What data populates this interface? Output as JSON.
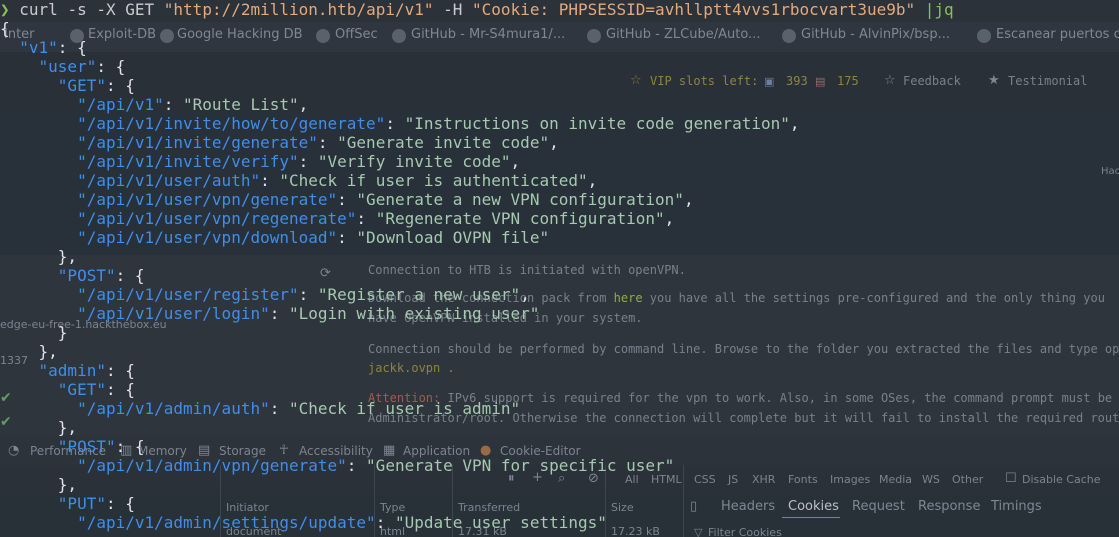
{
  "terminal": {
    "prompt_symbol": "❯",
    "command": {
      "prefix": "curl -s -X GET ",
      "url": "\"http://2million.htb/api/v1\"",
      "middle": " -H ",
      "header": "\"Cookie: PHPSESSID=avhllptt4vvs1rbocvart3ue9b\"",
      "pipe": " |jq"
    },
    "root_key": "\"v1\"",
    "user_key": "\"user\"",
    "admin_key": "\"admin\"",
    "get_key": "\"GET\"",
    "post_key": "\"POST\"",
    "put_key": "\"PUT\"",
    "user_get": [
      {
        "route": "\"/api/v1\"",
        "desc": "\"Route List\""
      },
      {
        "route": "\"/api/v1/invite/how/to/generate\"",
        "desc": "\"Instructions on invite code generation\""
      },
      {
        "route": "\"/api/v1/invite/generate\"",
        "desc": "\"Generate invite code\""
      },
      {
        "route": "\"/api/v1/invite/verify\"",
        "desc": "\"Verify invite code\""
      },
      {
        "route": "\"/api/v1/user/auth\"",
        "desc": "\"Check if user is authenticated\""
      },
      {
        "route": "\"/api/v1/user/vpn/generate\"",
        "desc": "\"Generate a new VPN configuration\""
      },
      {
        "route": "\"/api/v1/user/vpn/regenerate\"",
        "desc": "\"Regenerate VPN configuration\""
      },
      {
        "route": "\"/api/v1/user/vpn/download\"",
        "desc": "\"Download OVPN file\""
      }
    ],
    "user_post": [
      {
        "route": "\"/api/v1/user/register\"",
        "desc": "\"Register a new user\""
      },
      {
        "route": "\"/api/v1/user/login\"",
        "desc": "\"Login with existing user\""
      }
    ],
    "admin_get": [
      {
        "route": "\"/api/v1/admin/auth\"",
        "desc": "\"Check if user is admin\""
      }
    ],
    "admin_post": [
      {
        "route": "\"/api/v1/admin/vpn/generate\"",
        "desc": "\"Generate VPN for specific user\""
      }
    ],
    "admin_put": [
      {
        "route": "\"/api/v1/admin/settings/update\"",
        "desc": "\"Update user settings\""
      }
    ]
  },
  "background": {
    "bookmarks": [
      "Inter",
      "Exploit-DB",
      "Google Hacking DB",
      "OffSec",
      "GitHub - Mr-S4mura1/...",
      "GitHub - ZLCube/Auto...",
      "GitHub - AlvinPix/bsp...",
      "Escanear puertos c"
    ],
    "vip_label": "VIP slots left:",
    "vip_eu": "393",
    "vip_us": "175",
    "feedback": "Feedback",
    "testimonial": "Testimonial",
    "hac_fragment": "Hac",
    "server_fragment": "edge-eu-free-1.hackthebox.eu",
    "port_fragment": "1337",
    "vpn_text_1": "Connection to HTB is initiated with openVPN.",
    "vpn_text_2a": "Download the connection pack from ",
    "vpn_text_2_link": "here",
    "vpn_text_2b": " you have all the settings pre-configured and the only thing you",
    "vpn_text_3": "have OpenVPN installed in your system.",
    "vpn_text_4": "Connection should be performed by command line. Browse to the folder you extracted the files and type  openv",
    "vpn_text_5": "jackk.ovpn .",
    "vpn_text_6a": "Attention:",
    "vpn_text_6b": " IPv6 support is required for the vpn to work. Also, in some OSes, the command prompt must be run",
    "vpn_text_7": "Administrator/root. Otherwise the connection will complete but it will fail to install the required routes to",
    "devtools_tabs": [
      "Performance",
      "Memory",
      "Storage",
      "Accessibility",
      "Application",
      "Cookie-Editor"
    ],
    "filter_types": [
      "All",
      "HTML",
      "CSS",
      "JS",
      "XHR",
      "Fonts",
      "Images",
      "Media",
      "WS",
      "Other"
    ],
    "disable_cache": "Disable Cache",
    "col_headers": [
      "Initiator",
      "Type",
      "Transferred",
      "Size"
    ],
    "row_initiator": "document",
    "row_type": "html",
    "row_transferred": "17.31 kB",
    "row_size": "17.23 kB",
    "panel_tabs": [
      "Headers",
      "Cookies",
      "Request",
      "Response",
      "Timings"
    ],
    "filter_cookies": "Filter Cookies",
    "colors": {
      "terminal_green": "#8cc152",
      "json_key": "#3f8eea",
      "json_value": "#a6c9b0",
      "string_orange": "#e5a97a"
    }
  }
}
